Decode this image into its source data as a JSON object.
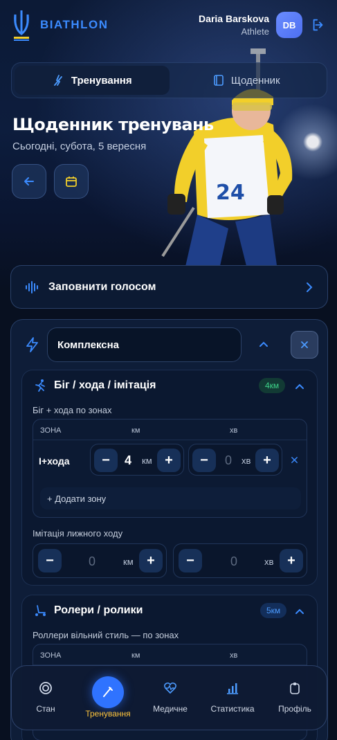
{
  "app": {
    "brand": "BIATHLON",
    "user_name": "Daria Barskova",
    "user_role": "Athlete",
    "avatar_initials": "DB"
  },
  "tabs": [
    {
      "label": "Тренування",
      "active": true,
      "icon": "ski-athlete-icon"
    },
    {
      "label": "Щоденник",
      "active": false,
      "icon": "notebook-icon"
    }
  ],
  "page": {
    "title": "Щоденник тренувань",
    "subtitle": "Сьогодні, субота, 5 вересня"
  },
  "voice": {
    "label": "Заповнити голосом"
  },
  "training_type": {
    "value": "Комплексна"
  },
  "sections": [
    {
      "title": "Біг / хода / імітація",
      "badge": "4км",
      "badge_color": "#3ed48a",
      "subtitle": "Біг + хода по зонах",
      "columns": [
        "ЗОНА",
        "км",
        "хв"
      ],
      "rows": [
        {
          "zone": "І+хода",
          "km": "4",
          "km_unit": "км",
          "min": "0",
          "min_unit": "хв"
        }
      ],
      "add_zone_label": "+ Додати зону",
      "imitation": {
        "label": "Імітація лижного ходу",
        "km": "0",
        "km_unit": "км",
        "min": "0",
        "min_unit": "хв"
      }
    },
    {
      "title": "Ролери / ролики",
      "badge": "5км",
      "badge_color": "#4c9bff",
      "subtitle": "Роллери вільний стиль — по зонах",
      "columns": [
        "ЗОНА",
        "км",
        "хв"
      ]
    }
  ],
  "nav": [
    {
      "label": "Стан",
      "icon": "target-icon",
      "active": false
    },
    {
      "label": "Тренування",
      "icon": "pen-icon",
      "active": true
    },
    {
      "label": "Медичне",
      "icon": "heart-pulse-icon",
      "active": false
    },
    {
      "label": "Статистика",
      "icon": "bar-chart-icon",
      "active": false
    },
    {
      "label": "Профіль",
      "icon": "badge-icon",
      "active": false
    }
  ],
  "colors": {
    "accent": "#3b8bff",
    "active_nav": "#ffc53d",
    "background": "#081020"
  }
}
